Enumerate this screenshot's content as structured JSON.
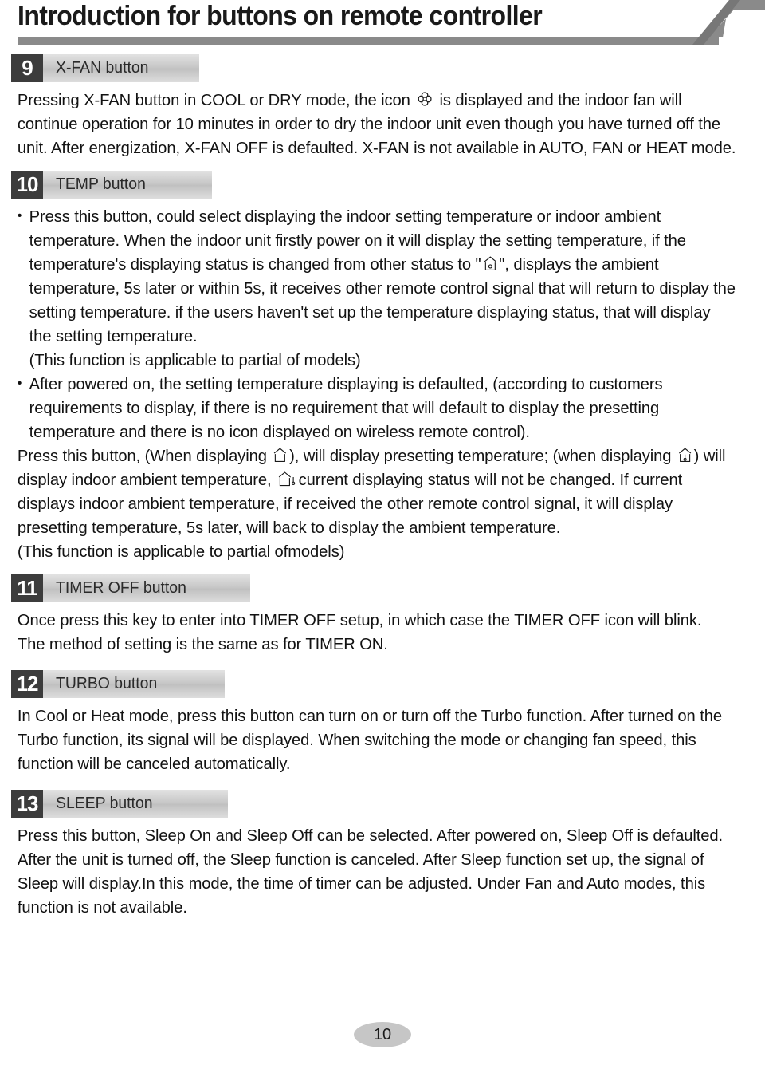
{
  "header": {
    "title": "Introduction for buttons on remote controller",
    "flag_icon": "corner-flag-decoration"
  },
  "sections": [
    {
      "number": "9",
      "label": "X-FAN button",
      "paragraphs": [
        "Pressing X-FAN button in COOL or DRY mode, the icon ",
        " is displayed and the indoor fan will continue operation for 10 minutes in order to dry the indoor unit even though you have turned off the unit. After energization, X-FAN OFF is defaulted. X-FAN is not available in AUTO, FAN or HEAT mode."
      ]
    },
    {
      "number": "10",
      "label": "TEMP button",
      "p1_a": "Press this button, could select displaying the indoor setting temperature or indoor ambient temperature. When the indoor unit firstly power on it will display the setting temperature, if the temperature's displaying status is changed from other status to \"",
      "p1_b": "\", displays the ambient temperature, 5s later or within 5s, it receives other remote control signal that will return to display the setting temperature. if the users haven't set up the temperature displaying status, that will display the setting temperature.",
      "p1_c": "(This function is applicable to partial of models)",
      "p2": "After powered on, the setting temperature displaying is defaulted, (according to customers requirements to display, if there is no requirement that will default to display the presetting temperature and there is no icon displayed on wireless remote control).",
      "p3_a": "Press this button, (When displaying ",
      "p3_b": "), will display presetting temperature; (when displaying ",
      "p3_c": ") will display indoor ambient temperature, ",
      "p3_d": "current displaying status will not be changed. If current displays indoor ambient temperature, if received the other remote control signal, it will display presetting temperature, 5s later, will back to display the ambient temperature.",
      "p4": "(This function is applicable to partial ofmodels)"
    },
    {
      "number": "11",
      "label": "TIMER OFF button",
      "paragraphs": [
        "Once press this key to enter into TIMER OFF setup, in which case the TIMER OFF icon will blink.",
        "The method of setting is the same as for TIMER ON."
      ]
    },
    {
      "number": "12",
      "label": "TURBO button",
      "paragraphs": [
        "In Cool or Heat mode, press this button can turn on or turn off the Turbo function. After turned on the Turbo function, its signal will be displayed. When switching the mode or changing fan speed, this function will be canceled automatically."
      ]
    },
    {
      "number": "13",
      "label": "SLEEP button",
      "paragraphs": [
        "Press this button, Sleep On and Sleep Off can be selected. After powered on, Sleep Off is defaulted. After the unit is turned off, the Sleep function is canceled. After Sleep function set up, the signal of Sleep will display.In this mode, the time of timer can be adjusted. Under Fan and Auto modes, this function is not available."
      ]
    }
  ],
  "icons": {
    "xfan": "x-fan-four-petal-icon",
    "house_circle": "house-with-circle-icon",
    "house_empty": "house-empty-icon",
    "house_thermometer": "house-with-thermometer-icon",
    "house_thermometer_outside": "house-with-outside-thermometer-icon"
  },
  "footer": {
    "page_number": "10"
  },
  "colors": {
    "section_number_bg": "#3c3c3c",
    "section_label_bg": "#c6c6c6",
    "rule": "#8a8a8a",
    "text": "#121212",
    "page_badge_bg": "#c6c6c6"
  }
}
